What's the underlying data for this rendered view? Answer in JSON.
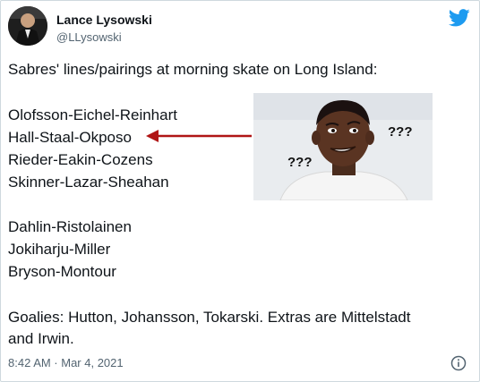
{
  "author": {
    "name": "Lance Lysowski",
    "handle": "@LLysowski"
  },
  "tweet": {
    "intro": "Sabres' lines/pairings at morning skate on Long Island:",
    "forward_lines": [
      "Olofsson-Eichel-Reinhart",
      "Hall-Staal-Okposo",
      "Rieder-Eakin-Cozens",
      "Skinner-Lazar-Sheahan"
    ],
    "defense_pairs": [
      "Dahlin-Ristolainen",
      "Jokiharju-Miller",
      "Bryson-Montour"
    ],
    "goalies_line1": "Goalies: Hutton, Johansson, Tokarski. Extras are Mittelstadt",
    "goalies_line2": "and Irwin.",
    "timestamp": "8:42 AM · Mar 4, 2021"
  },
  "meme": {
    "marks_right": "???",
    "marks_left": "???",
    "arrow_color": "#b01515"
  },
  "colors": {
    "twitter_blue": "#1d9bf0",
    "text": "#0f1419",
    "muted": "#536471"
  }
}
